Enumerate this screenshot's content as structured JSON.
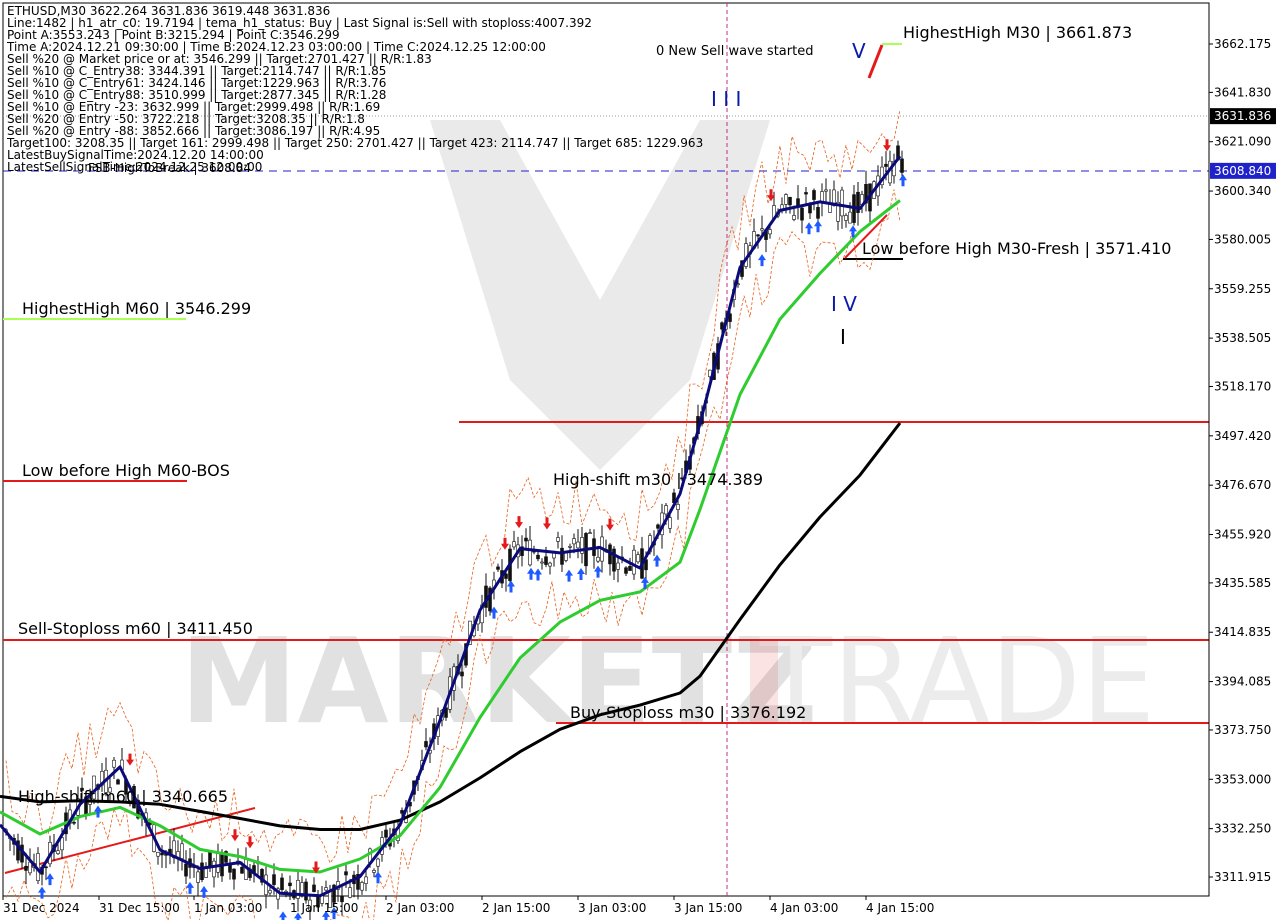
{
  "header": {
    "lines": [
      "ETHUSD,M30  3622.264 3631.836 3619.448 3631.836",
      "Line:1482  | h1_atr_c0: 19.7194  | tema_h1_status: Buy  | Last Signal is:Sell with stoploss:4007.392",
      "Point A:3553.243  | Point B:3215.294  | Point C:3546.299",
      "Time A:2024.12.21 09:30:00  | Time B:2024.12.23 03:00:00  | Time C:2024.12.25 12:00:00",
      "Sell %20 @ Market price or at: 3546.299  || Target:2701.427  || R/R:1.83",
      "Sell %10 @ C_Entry38: 3344.391  || Target:2114.747  || R/R:1.85",
      "Sell %10 @ C_Entry61: 3424.146  || Target:1229.963  || R/R:3.76",
      "Sell %10 @ C_Entry88: 3510.999  || Target:2877.345  || R/R:1.28",
      "Sell %10 @ Entry -23: 3632.999  || Target:2999.498  || R/R:1.69",
      "Sell %20 @ Entry -50: 3722.218  || Target:3208.35  || R/R:1.8",
      "Sell %20 @ Entry -88: 3852.666  || Target:3086.197  || R/R:4.95",
      "Target100: 3208.35  || Target 161: 2999.498  || Target 250: 2701.427  || Target 423: 2114.747  || Target 685: 1229.963",
      "LatestBuySignalTime:2024.12.20 14:00:00",
      "LatestSellSignalTime:2024.12.25 12:00:00"
    ],
    "overlap_text": "FSB-HighToBreak | 3608.84"
  },
  "chart_data": {
    "type": "line",
    "symbol": "ETHUSD",
    "timeframe": "M30",
    "ohlc_last": {
      "open": 3622.264,
      "high": 3631.836,
      "low": 3619.448,
      "close": 3631.836
    },
    "ylim": [
      3302,
      3673
    ],
    "y_ticks": [
      "3662.175",
      "3641.830",
      "3621.090",
      "3600.340",
      "3580.005",
      "3559.255",
      "3538.505",
      "3518.170",
      "3497.420",
      "3476.670",
      "3455.920",
      "3435.585",
      "3414.835",
      "3394.085",
      "3373.750",
      "3353.000",
      "3332.250",
      "3311.915"
    ],
    "x_ticks": [
      "31 Dec 2024",
      "31 Dec 15:00",
      "1 Jan 03:00",
      "1 Jan 15:00",
      "2 Jan 03:00",
      "2 Jan 15:00",
      "3 Jan 03:00",
      "3 Jan 15:00",
      "4 Jan 03:00",
      "4 Jan 15:00"
    ],
    "price_labels": [
      {
        "text": "3631.836",
        "value": 3631.836,
        "bg": "#000000",
        "fg": "#ffffff"
      },
      {
        "text": "3608.840",
        "value": 3608.84,
        "bg": "#1e22c8",
        "fg": "#ffffff"
      }
    ],
    "levels": [
      {
        "label": "HighestHigh   M30 | 3661.873",
        "value": 3661.873,
        "color": "#aaff55"
      },
      {
        "label": "Low before High   M30-Fresh | 3571.410",
        "value": 3571.41,
        "color": "#000000"
      },
      {
        "label": "HighestHigh   M60 | 3546.299",
        "value": 3546.299,
        "color": "#aaff55"
      },
      {
        "label": "Low before High   M60-BOS",
        "value": 3476.67,
        "color": "#e41a1a"
      },
      {
        "label": "Sell-Stoploss m60 | 3411.450",
        "value": 3411.45,
        "color": "#e41a1a"
      },
      {
        "label": "Buy-Stoploss m30 | 3376.192",
        "value": 3376.192,
        "color": "#e41a1a"
      },
      {
        "label": "High-shift m30 | 3474.389",
        "value": 3474.389,
        "color": "#000000"
      },
      {
        "label": "High-shift m60 | 3340.665",
        "value": 3340.665,
        "color": "#000000"
      },
      {
        "label": "",
        "value": 3501.5,
        "color": "#e41a1a"
      }
    ],
    "annotations": {
      "sell_wave": "0 New Sell wave started",
      "wave_III": "I I I",
      "wave_IV": "I V",
      "wave_V": "V",
      "wave_I": "I"
    },
    "series": [
      {
        "color": "#000000",
        "points": [
          [
            0,
            3345.8
          ],
          [
            40,
            3343.5
          ],
          [
            80,
            3344.0
          ],
          [
            120,
            3343.5
          ],
          [
            160,
            3342.5
          ],
          [
            200,
            3339.5
          ],
          [
            240,
            3336.5
          ],
          [
            280,
            3333.4
          ],
          [
            320,
            3331.9
          ],
          [
            360,
            3331.9
          ],
          [
            400,
            3335.8
          ],
          [
            440,
            3343.5
          ],
          [
            480,
            3353.6
          ],
          [
            520,
            3364.6
          ],
          [
            560,
            3374.0
          ],
          [
            600,
            3380.1
          ],
          [
            640,
            3384.2
          ],
          [
            680,
            3389.3
          ],
          [
            700,
            3396.4
          ],
          [
            740,
            3420.2
          ],
          [
            780,
            3443.2
          ],
          [
            820,
            3463.3
          ],
          [
            860,
            3480.9
          ],
          [
            900,
            3502.8
          ]
        ]
      },
      {
        "color": "#2ecc2e",
        "points": [
          [
            0,
            3339.3
          ],
          [
            40,
            3330.0
          ],
          [
            80,
            3337.3
          ],
          [
            120,
            3341.2
          ],
          [
            160,
            3333.5
          ],
          [
            200,
            3323.5
          ],
          [
            240,
            3320.5
          ],
          [
            280,
            3315.1
          ],
          [
            320,
            3314.0
          ],
          [
            360,
            3319.5
          ],
          [
            400,
            3329.3
          ],
          [
            440,
            3349.6
          ],
          [
            480,
            3379.0
          ],
          [
            520,
            3404.0
          ],
          [
            560,
            3419.1
          ],
          [
            600,
            3428.2
          ],
          [
            640,
            3431.8
          ],
          [
            680,
            3444.3
          ],
          [
            700,
            3466.5
          ],
          [
            740,
            3514.8
          ],
          [
            780,
            3546.5
          ],
          [
            820,
            3565.7
          ],
          [
            860,
            3583.3
          ],
          [
            900,
            3596.4
          ]
        ]
      },
      {
        "color": "#0a0a7a",
        "points": [
          [
            0,
            3333.9
          ],
          [
            40,
            3314.0
          ],
          [
            80,
            3342.5
          ],
          [
            120,
            3358.2
          ],
          [
            160,
            3323.3
          ],
          [
            200,
            3315.5
          ],
          [
            240,
            3318.0
          ],
          [
            280,
            3305.1
          ],
          [
            320,
            3304.0
          ],
          [
            360,
            3312.1
          ],
          [
            400,
            3333.8
          ],
          [
            440,
            3377.8
          ],
          [
            480,
            3424.1
          ],
          [
            520,
            3450.0
          ],
          [
            560,
            3448.2
          ],
          [
            600,
            3450.5
          ],
          [
            640,
            3441.8
          ],
          [
            680,
            3473.0
          ],
          [
            700,
            3502.6
          ],
          [
            740,
            3568.2
          ],
          [
            780,
            3592.2
          ],
          [
            820,
            3595.8
          ],
          [
            860,
            3593.0
          ],
          [
            900,
            3615.0
          ]
        ]
      }
    ]
  }
}
